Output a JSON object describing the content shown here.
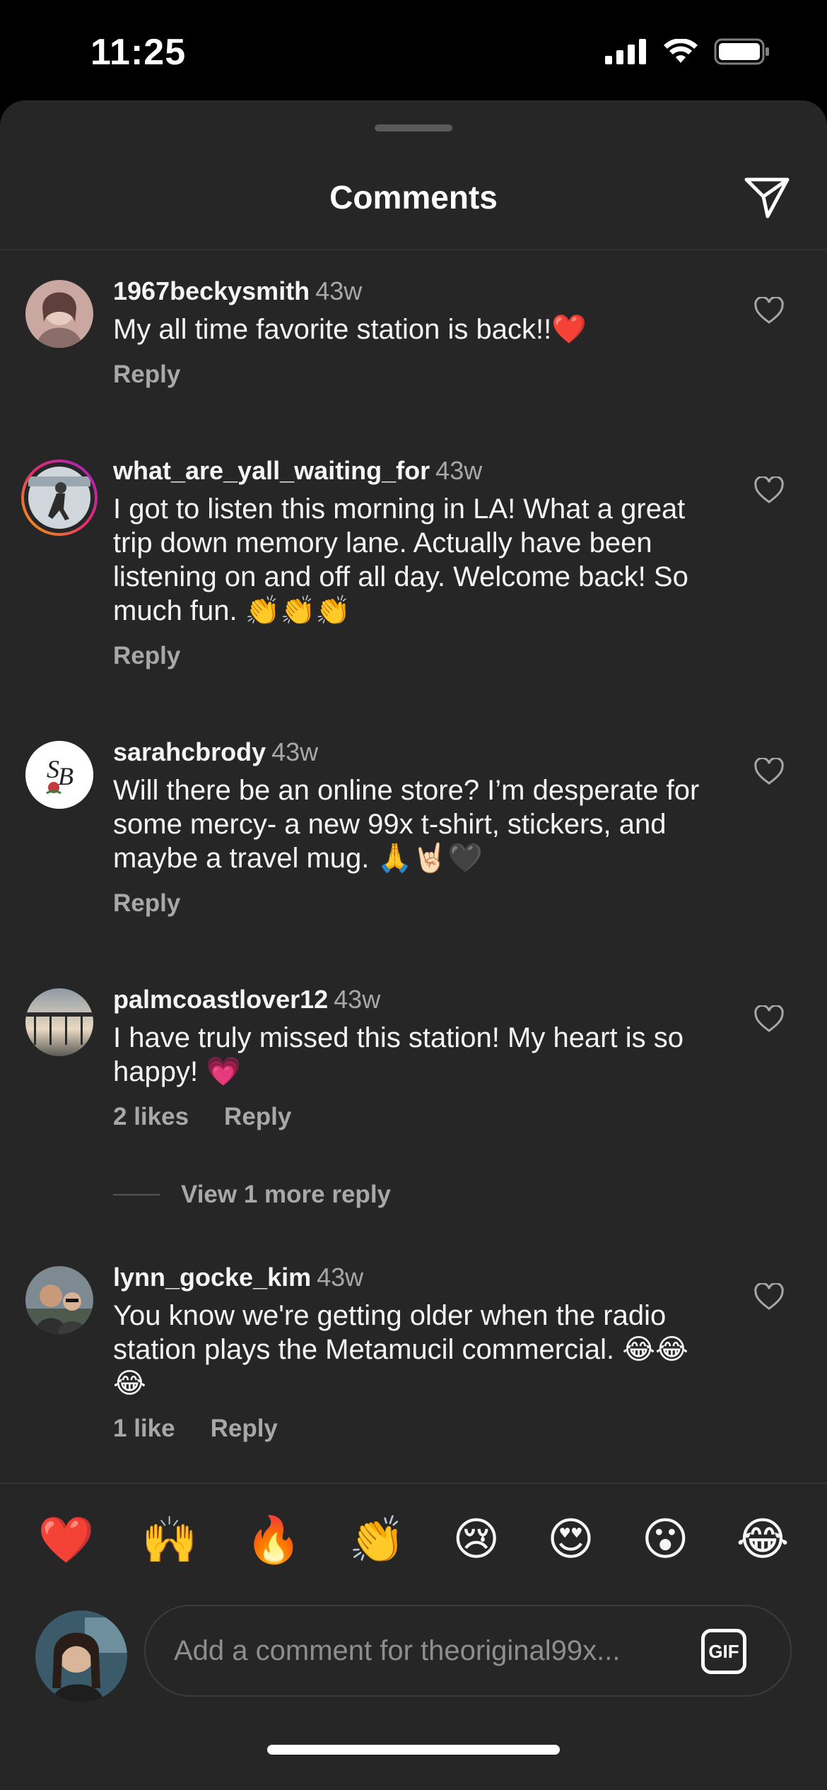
{
  "status_bar": {
    "time": "11:25"
  },
  "sheet": {
    "title": "Comments"
  },
  "comments": [
    {
      "username": "1967beckysmith",
      "time": "43w",
      "text": "My all time favorite station is back!!❤️",
      "actions": {
        "reply": "Reply"
      }
    },
    {
      "username": "what_are_yall_waiting_for",
      "time": "43w",
      "text": "I got to listen this morning in LA! What a great trip down memory lane. Actually have been listening on and off all day. Welcome back! So much fun. 👏👏👏",
      "actions": {
        "reply": "Reply"
      }
    },
    {
      "username": "sarahcbrody",
      "time": "43w",
      "text": "Will there be an online store? I’m desperate for some mercy- a new 99x t-shirt, stickers, and maybe a travel mug. 🙏🤘🏻🖤",
      "actions": {
        "reply": "Reply"
      }
    },
    {
      "username": "palmcoastlover12",
      "time": "43w",
      "text": "I have truly missed this station! My heart is so happy! 💗",
      "actions": {
        "likes": "2 likes",
        "reply": "Reply"
      },
      "view_more": "View 1 more reply"
    },
    {
      "username": "lynn_gocke_kim",
      "time": "43w",
      "text": "You know we're getting older when the radio station plays the Metamucil commercial. 😂😂😂",
      "actions": {
        "likes": "1 like",
        "reply": "Reply"
      }
    }
  ],
  "emoji_bar": [
    "❤️",
    "🙌",
    "🔥",
    "👏",
    "😢",
    "😍",
    "😮",
    "😂"
  ],
  "composer": {
    "placeholder": "Add a comment for theoriginal99x...",
    "gif_label": "GIF"
  }
}
